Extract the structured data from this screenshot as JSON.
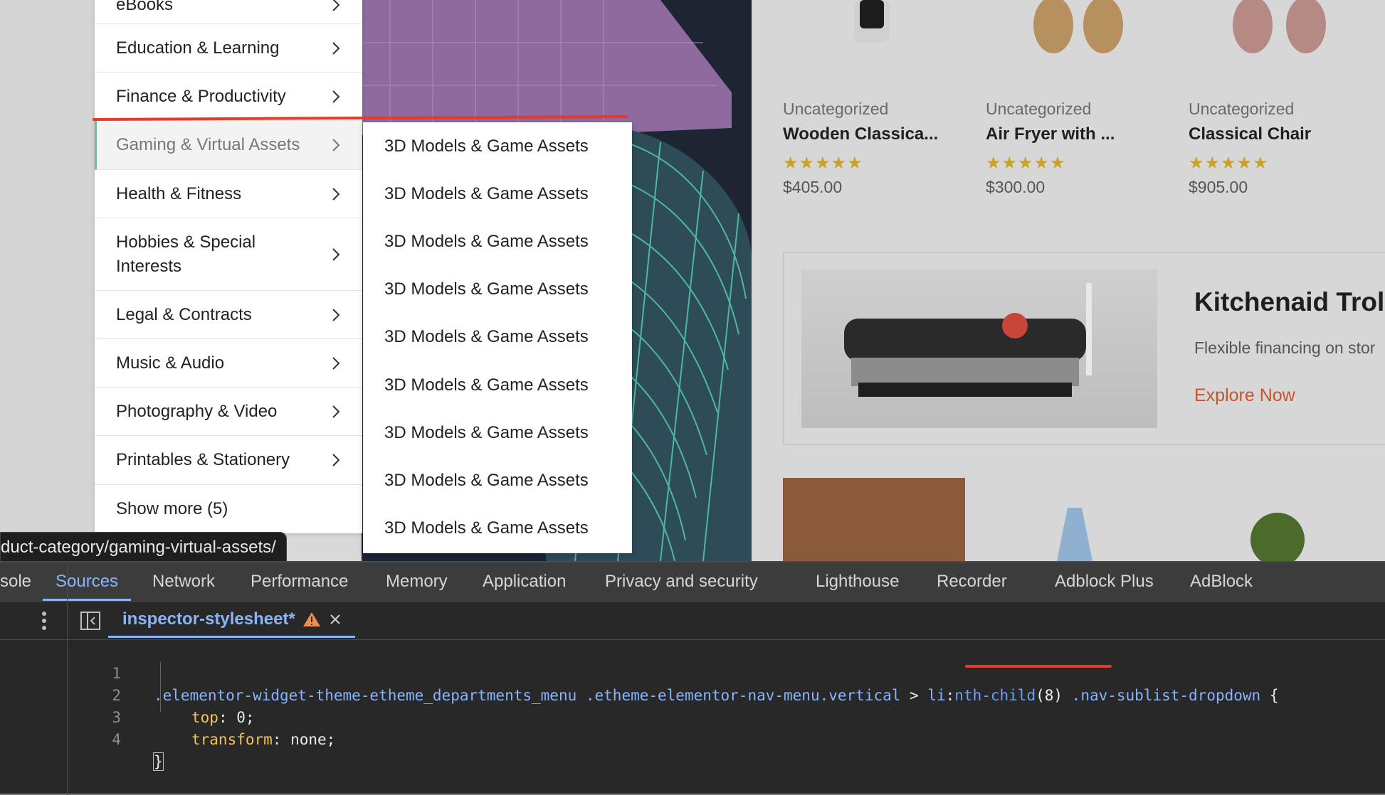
{
  "menu": {
    "partial_top_label": "eBooks",
    "items": [
      {
        "label": "Education & Learning"
      },
      {
        "label": "Finance & Productivity"
      },
      {
        "label": "Gaming & Virtual Assets",
        "active": true
      },
      {
        "label": "Health & Fitness"
      },
      {
        "label": "Hobbies & Special\nInterests"
      },
      {
        "label": "Legal & Contracts"
      },
      {
        "label": "Music & Audio"
      },
      {
        "label": "Photography & Video"
      },
      {
        "label": "Printables & Stationery"
      }
    ],
    "show_more": "Show more (5)"
  },
  "submenu": {
    "items": [
      "3D Models & Game Assets",
      "3D Models & Game Assets",
      "3D Models & Game Assets",
      "3D Models & Game Assets",
      "3D Models & Game Assets",
      "3D Models & Game Assets",
      "3D Models & Game Assets",
      "3D Models & Game Assets",
      "3D Models & Game Assets"
    ]
  },
  "status_url": "duct-category/gaming-virtual-assets/",
  "products": [
    {
      "category": "Uncategorized",
      "title": "Wooden Classica...",
      "rating": "★★★★★",
      "price": "$405.00"
    },
    {
      "category": "Uncategorized",
      "title": "Air Fryer with ...",
      "rating": "★★★★★",
      "price": "$300.00"
    },
    {
      "category": "Uncategorized",
      "title": "Classical Chair",
      "rating": "★★★★★",
      "price": "$905.00"
    }
  ],
  "promo": {
    "title": "Kitchenaid Trolly",
    "subtitle": "Flexible financing on stor",
    "link": "Explore Now"
  },
  "devtools": {
    "tabs": [
      "sole",
      "Sources",
      "Network",
      "Performance",
      "Memory",
      "Application",
      "Privacy and security",
      "Lighthouse",
      "Recorder",
      "Adblock Plus",
      "AdBlock"
    ],
    "active_tab": "Sources",
    "file_tab": "inspector-stylesheet*",
    "code_lines": [
      {
        "n": "1",
        "text": ".elementor-widget-theme-etheme_departments_menu .etheme-elementor-nav-menu.vertical > li:nth-child(8) .nav-sublist-dropdown {"
      },
      {
        "n": "2",
        "text": "top: 0;"
      },
      {
        "n": "3",
        "text": "transform: none;"
      },
      {
        "n": "4",
        "text": "}"
      }
    ],
    "code_parts": {
      "sel1": ".elementor-widget-theme-etheme_departments_menu",
      "sel2": " .etheme-elementor-nav-menu",
      "sel3": ".vertical",
      "combinator": " > ",
      "tag": "li",
      "colon": ":",
      "pseudo": "nth-child",
      "arg": "(8)",
      "sel4": " .nav-sublist-dropdown",
      "open": " {",
      "prop1": "top",
      "val1": "0",
      "prop2": "transform",
      "val2": "none",
      "close": "}"
    }
  },
  "colors": {
    "highlight_red": "#e53b2c",
    "devtools_accent": "#8ab4f8",
    "star": "#c9a227",
    "promo_link": "#c8532e"
  }
}
